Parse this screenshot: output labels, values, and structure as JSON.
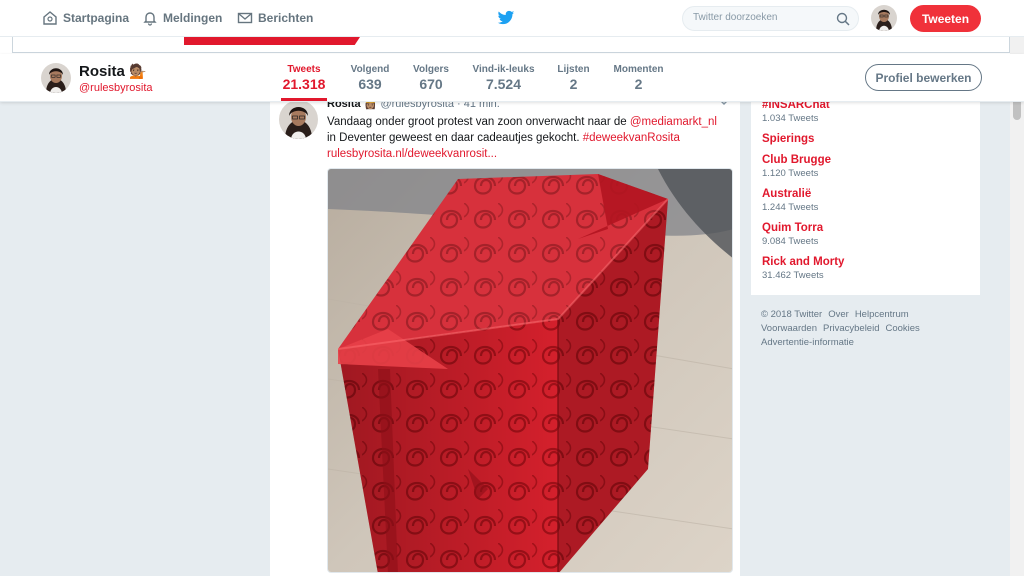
{
  "topnav": {
    "home": "Startpagina",
    "notifications": "Meldingen",
    "messages": "Berichten",
    "search_placeholder": "Twitter doorzoeken",
    "tweet_button": "Tweeten"
  },
  "profile": {
    "name": "Rosita",
    "emoji": "💁🏽",
    "handle": "@rulesbyrosita",
    "edit_button": "Profiel bewerken",
    "stats": [
      {
        "label": "Tweets",
        "value": "21.318"
      },
      {
        "label": "Volgend",
        "value": "639"
      },
      {
        "label": "Volgers",
        "value": "670"
      },
      {
        "label": "Vind-ik-leuks",
        "value": "7.524"
      },
      {
        "label": "Lijsten",
        "value": "2"
      },
      {
        "label": "Momenten",
        "value": "2"
      }
    ]
  },
  "tweet": {
    "name": "Rosita",
    "emoji": "👸🏽",
    "handle": "@rulesbyrosita",
    "time": "· 41 min.",
    "text_1": "Vandaag onder groot protest van zoon onverwacht naar de ",
    "mention": "@mediamarkt_nl",
    "text_2": " in Deventer geweest en daar cadeautjes gekocht. ",
    "hashtag": "#deweekvanRosita",
    "link": "rulesbyrosita.nl/deweekvanrosit..."
  },
  "trends": [
    {
      "name": "#INSARChat",
      "count": "1.034 Tweets"
    },
    {
      "name": "Spierings",
      "count": ""
    },
    {
      "name": "Club Brugge",
      "count": "1.120 Tweets"
    },
    {
      "name": "Australië",
      "count": "1.244 Tweets"
    },
    {
      "name": "Quim Torra",
      "count": "9.084 Tweets"
    },
    {
      "name": "Rick and Morty",
      "count": "31.462 Tweets"
    }
  ],
  "footer": {
    "line1": [
      "© 2018 Twitter",
      "Over",
      "Helpcentrum"
    ],
    "line2": [
      "Voorwaarden",
      "Privacybeleid",
      "Cookies"
    ],
    "line3": [
      "Advertentie-informatie"
    ]
  },
  "colors": {
    "accent": "#e1182d",
    "tweet_button": "#f0313a",
    "twitter_blue": "#1da1f2",
    "background": "#e6ecf0"
  }
}
